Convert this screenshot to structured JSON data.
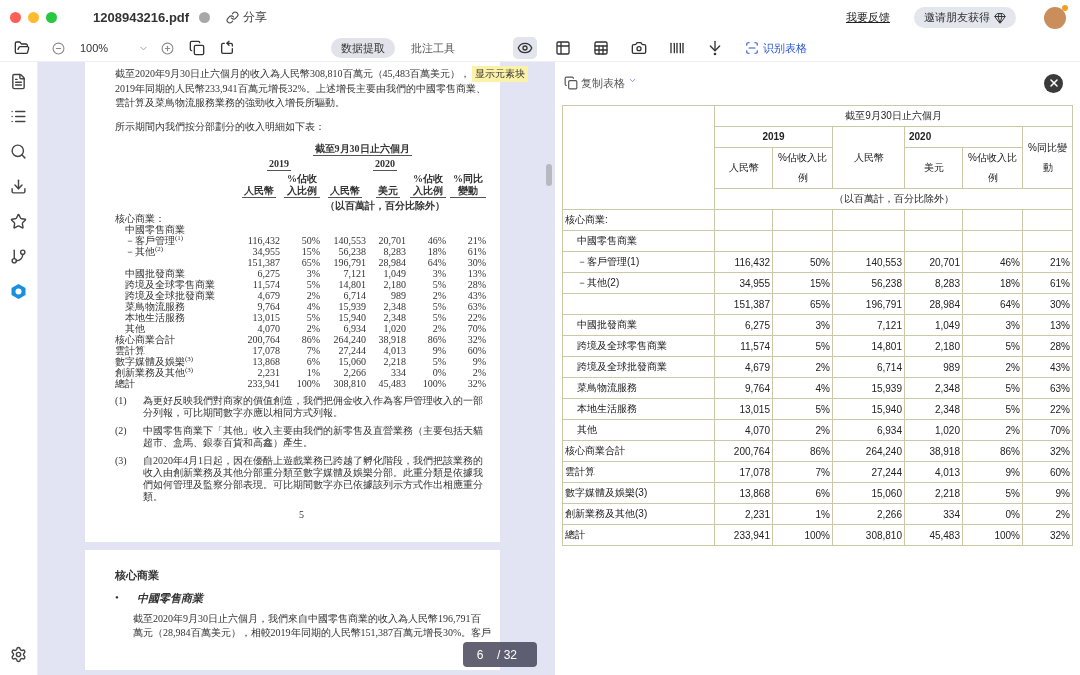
{
  "window": {
    "filename": "1208943216.pdf",
    "share": "分享",
    "feedback": "我要反馈",
    "invite": "邀请朋友获得"
  },
  "toolbar": {
    "zoom": "100%",
    "tabs": [
      {
        "label": "数据提取",
        "selected": true
      },
      {
        "label": "批注工具",
        "selected": false
      }
    ],
    "tools": [
      {
        "kind": "eye",
        "selected": true
      },
      {
        "kind": "table-cursor",
        "selected": false
      },
      {
        "kind": "table-x",
        "selected": false
      },
      {
        "kind": "camera",
        "selected": false
      },
      {
        "kind": "barcode",
        "selected": false
      },
      {
        "kind": "import",
        "selected": false
      }
    ],
    "recognize": "识别表格"
  },
  "sidebar": {
    "items": [
      {
        "kind": "document",
        "selected": false
      },
      {
        "kind": "list",
        "selected": false
      },
      {
        "kind": "search",
        "selected": false
      },
      {
        "kind": "download",
        "selected": false
      },
      {
        "kind": "star",
        "selected": false
      },
      {
        "kind": "branch",
        "selected": false
      },
      {
        "kind": "app",
        "selected": true
      },
      {
        "kind": "settings",
        "selected": false
      }
    ]
  },
  "document": {
    "tooltip": "显示元素块",
    "paragraph1_lines": [
      "截至2020年9月30日止六個月的收入為人民幣308,810百萬元（45,483百萬美元），",
      "2019年同期的人民幣233,941百萬元增長32%。上述增長主要由我們的中國零售商業、",
      "雲計算及菜鳥物流服務業務的強勁收入增長所驅動。"
    ],
    "paragraph2": "所示期間內我們按分部劃分的收入明細如下表：",
    "table": {
      "title": "截至9月30日止六個月",
      "years": [
        "2019",
        "2020"
      ],
      "columns": [
        "人民幣",
        "%佔收入比例",
        "人民幣",
        "美元",
        "%佔收入比例",
        "%同比變動"
      ],
      "unit": "（以百萬計，百分比除外）",
      "rows": [
        {
          "label": "核心商業：",
          "kind": "top"
        },
        {
          "label": "中國零售商業",
          "kind": "sub"
        },
        {
          "label": "－客戶管理$^{(1)}$",
          "kind": "sub",
          "cells": [
            "116,432",
            "50%",
            "140,553",
            "20,701",
            "46%",
            "21%"
          ]
        },
        {
          "label": "－其他$^{(2)}$",
          "kind": "sub",
          "cells": [
            "34,955",
            "15%",
            "56,238",
            "8,283",
            "18%",
            "61%"
          ]
        },
        {
          "kind": "sub",
          "cells": [
            "151,387",
            "65%",
            "196,791",
            "28,984",
            "64%",
            "30%"
          ]
        },
        {
          "label": "中國批發商業",
          "kind": "sub",
          "cells": [
            "6,275",
            "3%",
            "7,121",
            "1,049",
            "3%",
            "13%"
          ]
        },
        {
          "label": "跨境及全球零售商業",
          "kind": "sub",
          "cells": [
            "11,574",
            "5%",
            "14,801",
            "2,180",
            "5%",
            "28%"
          ]
        },
        {
          "label": "跨境及全球批發商業",
          "kind": "sub",
          "cells": [
            "4,679",
            "2%",
            "6,714",
            "989",
            "2%",
            "43%"
          ]
        },
        {
          "label": "菜鳥物流服務",
          "kind": "sub",
          "cells": [
            "9,764",
            "4%",
            "15,939",
            "2,348",
            "5%",
            "63%"
          ]
        },
        {
          "label": "本地生活服務",
          "kind": "sub",
          "cells": [
            "13,015",
            "5%",
            "15,940",
            "2,348",
            "5%",
            "22%"
          ]
        },
        {
          "label": "其他",
          "kind": "sub",
          "cells": [
            "4,070",
            "2%",
            "6,934",
            "1,020",
            "2%",
            "70%"
          ]
        },
        {
          "label": "核心商業合計",
          "kind": "top",
          "cells": [
            "200,764",
            "86%",
            "264,240",
            "38,918",
            "86%",
            "32%"
          ]
        },
        {
          "label": "雲計算",
          "kind": "top",
          "cells": [
            "17,078",
            "7%",
            "27,244",
            "4,013",
            "9%",
            "60%"
          ]
        },
        {
          "label": "數字媒體及娛樂$^{(3)}$",
          "kind": "top",
          "cells": [
            "13,868",
            "6%",
            "15,060",
            "2,218",
            "5%",
            "9%"
          ]
        },
        {
          "label": "創新業務及其他$^{(3)}$",
          "kind": "top",
          "cells": [
            "2,231",
            "1%",
            "2,266",
            "334",
            "0%",
            "2%"
          ]
        },
        {
          "label": "總計",
          "kind": "top",
          "cells": [
            "233,941",
            "100%",
            "308,810",
            "45,483",
            "100%",
            "32%"
          ]
        }
      ]
    },
    "footnotes": [
      {
        "mark": "(1)",
        "text": "為更好反映我們對商家的價值創造，我們把佣金收入作為客戶管理收入的一部分列報，可比期間數字亦應以相同方式列報。"
      },
      {
        "mark": "(2)",
        "text": "中國零售商業下「其他」收入主要由我們的新零售及直營業務（主要包括天貓超市、盒馬、銀泰百貨和高鑫）產生。"
      },
      {
        "mark": "(3)",
        "text": "自2020年4月1日起，因在優酷上遊戲業務已跨越了孵化階段，我們把該業務的收入由創新業務及其他分部重分類至數字媒體及娛樂分部。此重分類是依據我們如何管理及監察分部表現。可比期間數字亦已依據該列示方式作出相應重分類。"
      }
    ],
    "page_number": "5",
    "page2": {
      "heading": "核心商業",
      "bullet": "•",
      "subheading": "中國零售商業",
      "lines": [
        "截至2020年9月30日止六個月，我們來自中國零售商業的收入為人民幣196,791百",
        "萬元（28,984百萬美元），相較2019年同期的人民幣151,387百萬元增長30%。客戶"
      ]
    }
  },
  "page_indicator": {
    "current": "6",
    "total": "/ 32"
  },
  "extract_panel": {
    "copy": "复制表格",
    "table": {
      "title": "截至9月30日止六個月",
      "years": [
        "2019",
        "2020"
      ],
      "columns": [
        "人民幣",
        "%佔收入比例",
        "人民幣",
        "美元",
        "%佔收入比例",
        "%同比變動"
      ],
      "unit": "（以百萬計，百分比除外）",
      "rows": [
        {
          "label": "核心商業:",
          "kind": "top"
        },
        {
          "label": "中國零售商業",
          "kind": "sub"
        },
        {
          "label": "－客戶管理(1)",
          "kind": "sub",
          "cells": [
            "116,432",
            "50%",
            "140,553",
            "20,701",
            "46%",
            "21%"
          ]
        },
        {
          "label": "－其他(2)",
          "kind": "sub",
          "cells": [
            "34,955",
            "15%",
            "56,238",
            "8,283",
            "18%",
            "61%"
          ]
        },
        {
          "cells": [
            "151,387",
            "65%",
            "196,791",
            "28,984",
            "64%",
            "30%"
          ]
        },
        {
          "label": "中國批發商業",
          "kind": "sub",
          "cells": [
            "6,275",
            "3%",
            "7,121",
            "1,049",
            "3%",
            "13%"
          ]
        },
        {
          "label": "跨境及全球零售商業",
          "kind": "sub",
          "cells": [
            "11,574",
            "5%",
            "14,801",
            "2,180",
            "5%",
            "28%"
          ]
        },
        {
          "label": "跨境及全球批發商業",
          "kind": "sub",
          "cells": [
            "4,679",
            "2%",
            "6,714",
            "989",
            "2%",
            "43%"
          ]
        },
        {
          "label": "菜鳥物流服務",
          "kind": "sub",
          "cells": [
            "9,764",
            "4%",
            "15,939",
            "2,348",
            "5%",
            "63%"
          ]
        },
        {
          "label": "本地生活服務",
          "kind": "sub",
          "cells": [
            "13,015",
            "5%",
            "15,940",
            "2,348",
            "5%",
            "22%"
          ]
        },
        {
          "label": "其他",
          "kind": "sub",
          "cells": [
            "4,070",
            "2%",
            "6,934",
            "1,020",
            "2%",
            "70%"
          ]
        },
        {
          "label": "核心商業合計",
          "kind": "top",
          "cells": [
            "200,764",
            "86%",
            "264,240",
            "38,918",
            "86%",
            "32%"
          ]
        },
        {
          "label": "雲計算",
          "kind": "top",
          "cells": [
            "17,078",
            "7%",
            "27,244",
            "4,013",
            "9%",
            "60%"
          ]
        },
        {
          "label": "數字媒體及娛樂(3)",
          "kind": "top",
          "cells": [
            "13,868",
            "6%",
            "15,060",
            "2,218",
            "5%",
            "9%"
          ]
        },
        {
          "label": "創新業務及其他(3)",
          "kind": "top",
          "cells": [
            "2,231",
            "1%",
            "2,266",
            "334",
            "0%",
            "2%"
          ]
        },
        {
          "label": "總計",
          "kind": "top",
          "cells": [
            "233,941",
            "100%",
            "308,810",
            "45,483",
            "100%",
            "32%"
          ]
        }
      ]
    }
  }
}
